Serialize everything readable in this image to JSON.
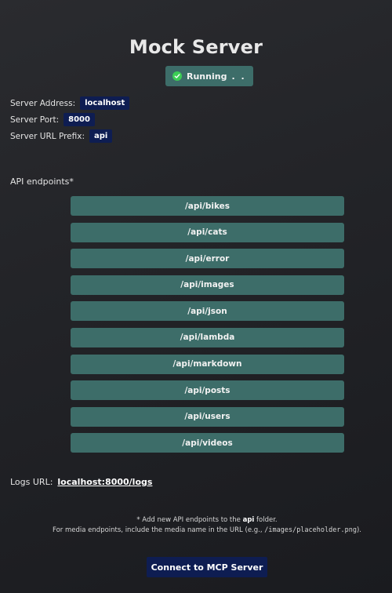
{
  "title": "Mock Server",
  "status": {
    "label": "Running",
    "indicator": ". ."
  },
  "server": {
    "address_label": "Server Address:",
    "address": "localhost",
    "port_label": "Server Port:",
    "port": "8000",
    "prefix_label": "Server URL Prefix:",
    "prefix": "api"
  },
  "endpoints_label": "API endpoints*",
  "endpoints": [
    "/api/bikes",
    "/api/cats",
    "/api/error",
    "/api/images",
    "/api/json",
    "/api/lambda",
    "/api/markdown",
    "/api/posts",
    "/api/users",
    "/api/videos"
  ],
  "logs": {
    "label": "Logs URL:",
    "url": "localhost:8000/logs"
  },
  "notes": {
    "line1_prefix": "* Add new API endpoints to the ",
    "line1_folder": "api",
    "line1_suffix": " folder.",
    "line2_prefix": "For media endpoints, include the media name in the URL (e.g., ",
    "line2_example": "/images/placeholder.png",
    "line2_suffix": ")."
  },
  "mcp_button": "Connect to MCP Server",
  "colors": {
    "accent": "#3d6d69",
    "tag": "#0e1d52",
    "status_ok": "#3ccd55"
  },
  "icons": {
    "status": "check-circle-icon"
  }
}
